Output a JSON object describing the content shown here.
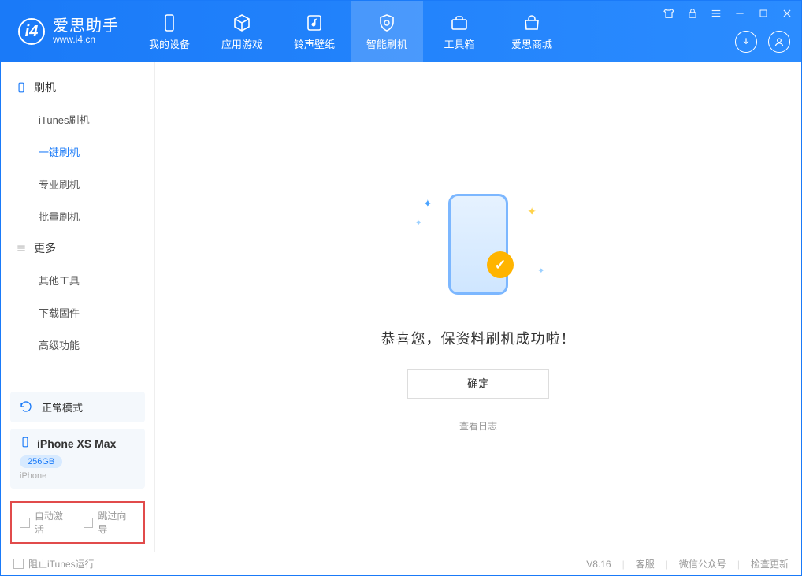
{
  "logo": {
    "title": "爱思助手",
    "url": "www.i4.cn"
  },
  "tabs": [
    {
      "label": "我的设备"
    },
    {
      "label": "应用游戏"
    },
    {
      "label": "铃声壁纸"
    },
    {
      "label": "智能刷机"
    },
    {
      "label": "工具箱"
    },
    {
      "label": "爱思商城"
    }
  ],
  "sidebar": {
    "group1": {
      "title": "刷机",
      "items": [
        "iTunes刷机",
        "一键刷机",
        "专业刷机",
        "批量刷机"
      ]
    },
    "group2": {
      "title": "更多",
      "items": [
        "其他工具",
        "下载固件",
        "高级功能"
      ]
    },
    "mode_card": "正常模式",
    "device": {
      "name": "iPhone XS Max",
      "storage": "256GB",
      "type": "iPhone"
    },
    "opts": {
      "auto_activate": "自动激活",
      "skip_guide": "跳过向导"
    }
  },
  "main": {
    "success_message": "恭喜您，保资料刷机成功啦！",
    "ok_label": "确定",
    "log_link": "查看日志"
  },
  "statusbar": {
    "block_itunes": "阻止iTunes运行",
    "version": "V8.16",
    "support": "客服",
    "wechat": "微信公众号",
    "update": "检查更新"
  }
}
